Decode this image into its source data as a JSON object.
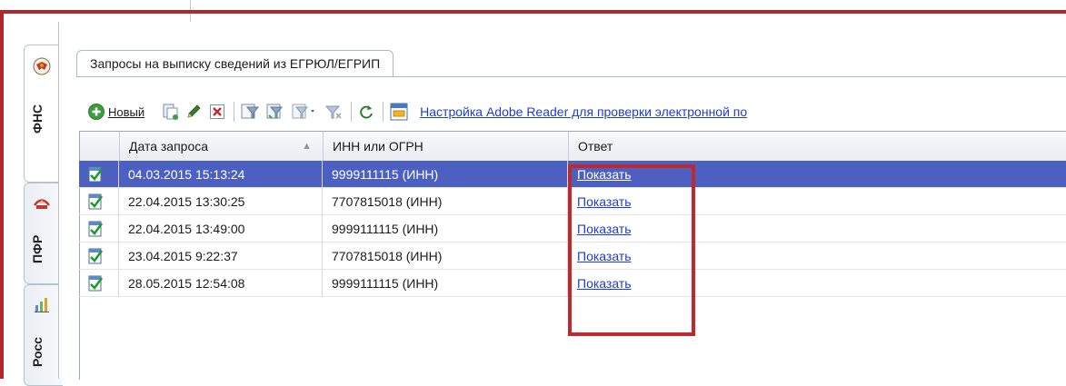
{
  "side_tabs": [
    {
      "label": "ФНС",
      "icon": "eagle-emblem-icon"
    },
    {
      "label": "ПФР",
      "icon": "pfr-logo-icon"
    },
    {
      "label": "Росс",
      "icon": "bar-chart-icon"
    }
  ],
  "document_tab": {
    "label": "Запросы на выписку сведений из ЕГРЮЛ/ЕГРИП"
  },
  "toolbar": {
    "new_label": "Новый",
    "new_underlined_letter": "Н",
    "adobe_link": "Настройка Adobe Reader для проверки электронной по"
  },
  "table": {
    "columns": [
      "Дата запроса",
      "ИНН или ОГРН",
      "Ответ"
    ],
    "rows": [
      {
        "date": "04.03.2015 15:13:24",
        "inn": "9999111115 (ИНН)",
        "answer": "Показать",
        "selected": true
      },
      {
        "date": "22.04.2015 13:30:25",
        "inn": "7707815018 (ИНН)",
        "answer": "Показать",
        "selected": false
      },
      {
        "date": "22.04.2015 13:49:00",
        "inn": "9999111115 (ИНН)",
        "answer": "Показать",
        "selected": false
      },
      {
        "date": "23.04.2015 9:22:37",
        "inn": "7707815018 (ИНН)",
        "answer": "Показать",
        "selected": false
      },
      {
        "date": "28.05.2015 12:54:08",
        "inn": "9999111115 (ИНН)",
        "answer": "Показать",
        "selected": false
      }
    ]
  },
  "colors": {
    "selection": "#4b60c0",
    "annotation_border": "#c1272d",
    "link": "#1f3dcf"
  }
}
